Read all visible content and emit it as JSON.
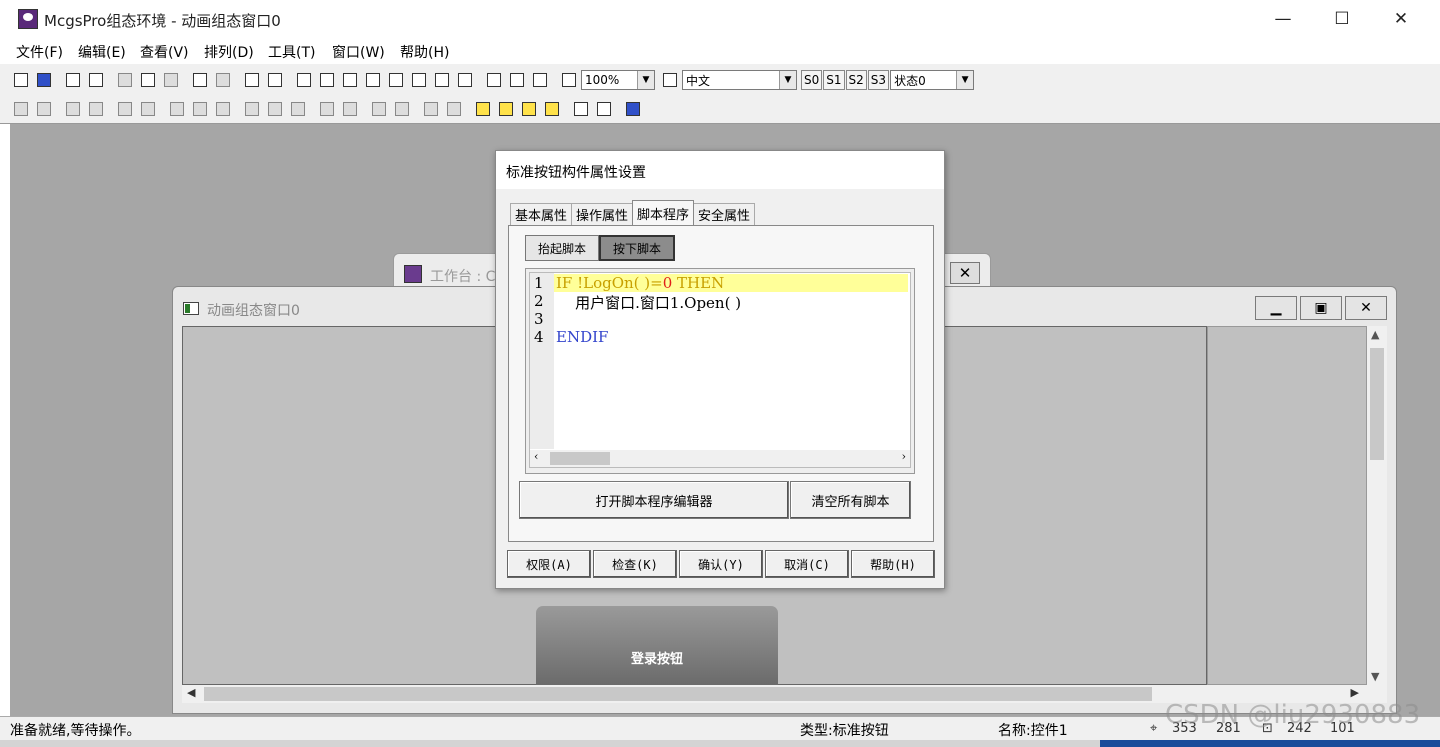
{
  "window": {
    "title": "McgsPro组态环境 - 动画组态窗口0",
    "minimize": "—",
    "maximize": "☐",
    "close": "✕"
  },
  "menu": [
    "文件(F)",
    "编辑(E)",
    "查看(V)",
    "排列(D)",
    "工具(T)",
    "窗口(W)",
    "帮助(H)"
  ],
  "toolbar": {
    "zoom": "100%",
    "language": "中文",
    "state_buttons": [
      "S0",
      "S1",
      "S2",
      "S3"
    ],
    "state_combo": "状态0"
  },
  "back_window": {
    "title": "工作台 : C",
    "close": "✕"
  },
  "anim_window": {
    "title": "动画组态窗口0",
    "login_button": "登录按钮"
  },
  "dialog": {
    "title": "标准按钮构件属性设置",
    "tabs": [
      "基本属性",
      "操作属性",
      "脚本程序",
      "安全属性"
    ],
    "active_tab": 2,
    "subtabs": [
      "抬起脚本",
      "按下脚本"
    ],
    "active_subtab": 1,
    "code": {
      "line_numbers": [
        "1",
        "2",
        "3",
        "4"
      ],
      "line1_a": "IF !LogOn( )=",
      "line1_b": "0",
      "line1_c": " THEN",
      "line2": "    用户窗口.窗口1.Open( )",
      "line3": "",
      "line4": "ENDIF"
    },
    "open_editor": "打开脚本程序编辑器",
    "clear_all": "清空所有脚本",
    "buttons": [
      "权限(A)",
      "检查(K)",
      "确认(Y)",
      "取消(C)",
      "帮助(H)"
    ]
  },
  "status": {
    "left": "准备就绪,等待操作。",
    "type": "类型:标准按钮",
    "name": "名称:控件1",
    "x": "353",
    "y": "281",
    "w": "242",
    "h": "101"
  },
  "watermark": "CSDN @liu2930883"
}
